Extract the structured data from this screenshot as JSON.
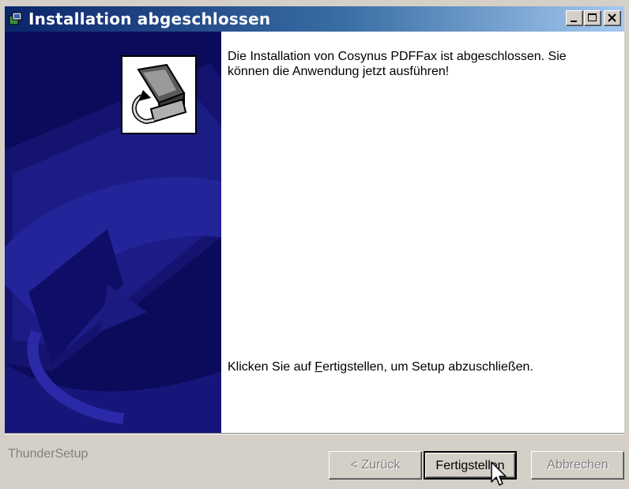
{
  "window": {
    "title": "Installation abgeschlossen",
    "controls": {
      "minimize": "minimize-icon",
      "maximize": "maximize-icon",
      "close": "close-icon"
    }
  },
  "main": {
    "message_complete": "Die Installation von Cosynus PDFFax ist abgeschlossen. Sie können die Anwendung jetzt ausführen!",
    "finish_prefix": "Klicken Sie auf ",
    "finish_mnemonic": "F",
    "finish_rest": "ertigstellen, um Setup abzuschließen."
  },
  "footer": {
    "brand": "ThunderSetup",
    "back_label": "< Zurück",
    "finish_label": "Fertigstellen",
    "cancel_label": "Abbrechen"
  },
  "colors": {
    "title_start": "#0a246a",
    "title_end": "#a6caf0",
    "banner": "#0b0b5c",
    "face": "#d4d0c8"
  }
}
